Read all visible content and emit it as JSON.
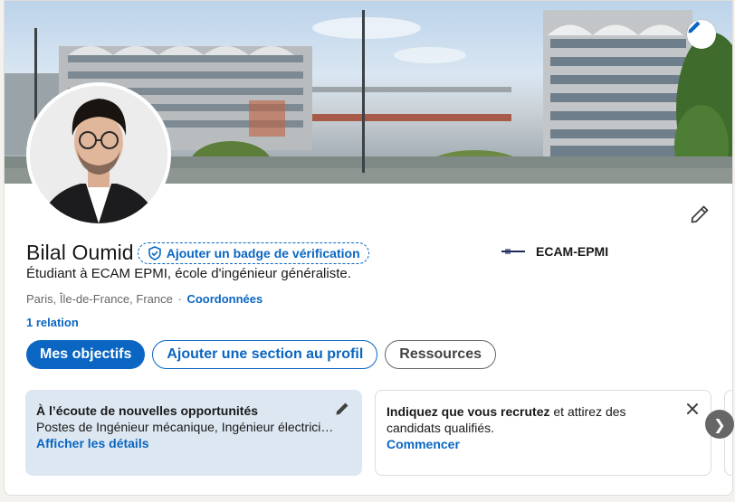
{
  "profile": {
    "name": "Bilal Oumid",
    "verify_badge_label": "Ajouter un badge de vérification",
    "headline": "Étudiant à ECAM EPMI, école d'ingénieur généraliste.",
    "location": "Paris, Île-de-France, France",
    "location_separator": "·",
    "contact_link": "Coordonnées",
    "relations": "1 relation",
    "organization": "ECAM-EPMI"
  },
  "actions": {
    "primary": "Mes objectifs",
    "add_section": "Ajouter une section au profil",
    "resources": "Ressources"
  },
  "open_to_work": {
    "title": "À l’écoute de nouvelles opportunités",
    "text": "Postes de Ingénieur mécanique, Ingénieur électricien…",
    "link": "Afficher les détails"
  },
  "recruit": {
    "bold": "Indiquez que vous recrutez",
    "text": " et attirez des candidats qualifiés.",
    "link": "Commencer"
  },
  "icons": {
    "banner_edit": "pencil-icon",
    "profile_edit": "pencil-icon",
    "verify": "shield-check-icon",
    "open_edit": "pencil-icon",
    "recruit_close": "close-icon",
    "carousel_next": "chevron-right-icon"
  },
  "colors": {
    "accent": "#0a66c2",
    "open_to_work_bg": "#dde7f1"
  }
}
